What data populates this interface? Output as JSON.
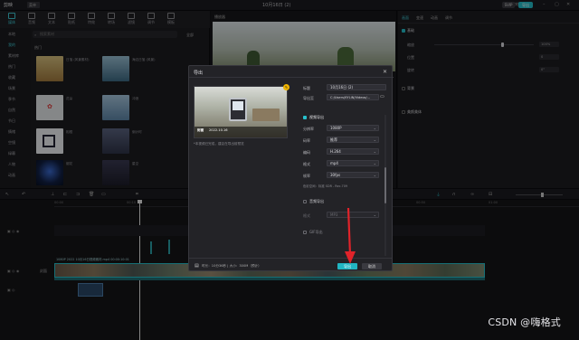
{
  "app": {
    "name": "剪映",
    "menu": "菜单",
    "title": "10月16日 (2)",
    "shortcut_label": "快捷键",
    "pro_label": "SVIP",
    "export_label": "导出"
  },
  "media_tabs": [
    {
      "label": "媒体",
      "icon": "media-icon"
    },
    {
      "label": "音频",
      "icon": "audio-icon"
    },
    {
      "label": "文本",
      "icon": "text-icon"
    },
    {
      "label": "贴纸",
      "icon": "sticker-icon"
    },
    {
      "label": "特效",
      "icon": "effects-icon"
    },
    {
      "label": "转场",
      "icon": "transition-icon"
    },
    {
      "label": "滤镜",
      "icon": "filter-icon"
    },
    {
      "label": "调节",
      "icon": "adjust-icon"
    },
    {
      "label": "模板",
      "icon": "template-icon"
    }
  ],
  "sidenav": [
    "本地",
    "我的",
    "素材库",
    "热门",
    "收藏",
    "场景",
    "季节",
    "自然",
    "节日",
    "情绪",
    "空镜",
    "绿幕",
    "人物",
    "动画",
    "旅行",
    "美食"
  ],
  "search": {
    "placeholder": "搜索素材",
    "filter": "全部"
  },
  "section_label": "热门",
  "thumbs": [
    {
      "caption": "日落 (风景素材)",
      "color": "#c9b273"
    },
    {
      "caption": "海边日落 (风景)",
      "color": "#5e8da8"
    },
    {
      "caption": "花朵",
      "color": "#dfe3e6"
    },
    {
      "caption": "冲浪",
      "color": "#7aa2c4"
    },
    {
      "caption": "相框",
      "color": "#e9ecef"
    },
    {
      "caption": "倒计时",
      "color": "#4e566e"
    },
    {
      "caption": "烟花",
      "color": "#1a2a4a"
    },
    {
      "caption": "星空",
      "color": "#2b2b3f"
    }
  ],
  "player": {
    "label": "播放器"
  },
  "props": {
    "tabs": [
      "画面",
      "变速",
      "动画",
      "调节"
    ],
    "sections": [
      "基础",
      "背景",
      "美颜美体"
    ],
    "rows": [
      {
        "label": "缩放",
        "value": "100%"
      },
      {
        "label": "位置",
        "value": "0"
      },
      {
        "label": "旋转",
        "value": "0°"
      }
    ]
  },
  "dialog": {
    "title": "导出",
    "cover_caption": "封面",
    "cover_timestamp": "2022.10.16",
    "edit_cover": "编辑封面",
    "hint": "*本视频已完成，建议在导出前预览",
    "fields": [
      {
        "label": "标题",
        "value": "10月16日 (2)",
        "chevron": ""
      },
      {
        "label": "导出至",
        "value": "C:/Users/KYLIN/Videos/...",
        "chevron": "▭"
      }
    ],
    "video_section": "视频导出",
    "video_fields": [
      {
        "label": "分辨率",
        "value": "1080P"
      },
      {
        "label": "码率",
        "value": "推荐"
      },
      {
        "label": "编码",
        "value": "H.264"
      },
      {
        "label": "格式",
        "value": "mp4"
      },
      {
        "label": "帧率",
        "value": "30fps"
      }
    ],
    "color_space": "色彩空间：标准 SDR - Rec.709",
    "audio_section": "音频导出",
    "audio_fields": [
      {
        "label": "格式",
        "value": "MP3"
      }
    ],
    "gif_section": "GIF导出",
    "footer_info": "时长：10分36秒 | 大小：300M（预计）",
    "export_button": "导出",
    "cancel_button": "取消"
  },
  "timeline": {
    "ruler": [
      "00:00",
      "00:10",
      "00:20",
      "00:30",
      "00:40",
      "00:50",
      "01:00"
    ],
    "track_label": "封面",
    "clip_title": "1080P 2022 10月16日视频素材.mp4 00:00:10:01"
  },
  "watermark": "CSDN @嗨格式",
  "colors": {
    "accent": "#27c0cc",
    "arrow": "#e0232a",
    "button_primary": "#21b6c3"
  }
}
